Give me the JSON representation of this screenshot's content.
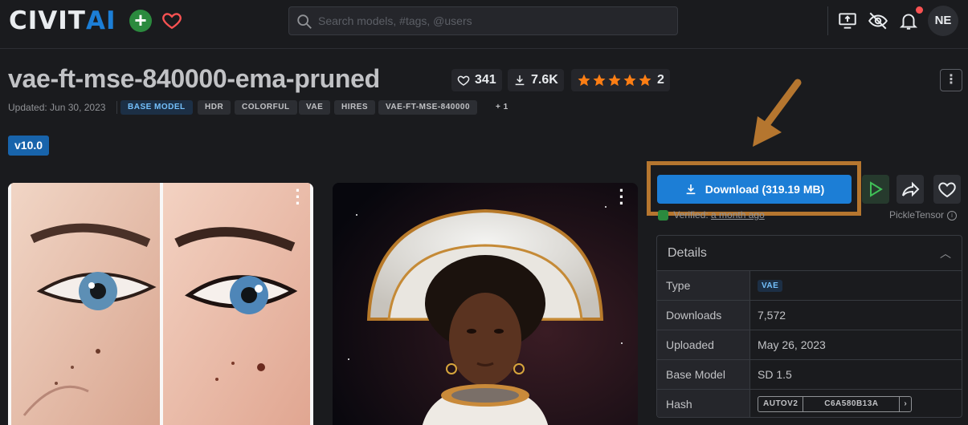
{
  "header": {
    "logo_civ": "CIVIT",
    "logo_ai": "AI",
    "search_placeholder": "Search models, #tags, @users",
    "avatar_initials": "NE",
    "icons": [
      "plus-icon",
      "heart-icon",
      "search-icon",
      "monitor-upload-icon",
      "eye-off-icon",
      "bell-icon"
    ],
    "accent": "#1c7ed6"
  },
  "model": {
    "title": "vae-ft-mse-840000-ema-pruned",
    "likes": "341",
    "downloads": "7.6K",
    "rating_count": "2",
    "rating_stars": 5,
    "updated": "Updated: Jun 30, 2023",
    "tags": [
      "BASE MODEL",
      "HDR",
      "COLORFUL",
      "VAE",
      "HIRES",
      "VAE-FT-MSE-840000",
      "+ 1"
    ],
    "version": "v10.0"
  },
  "actions": {
    "download_label": "Download (319.19 MB)",
    "verified_label": "Verified:",
    "verified_when": "a month ago",
    "author": "PickleTensor"
  },
  "details": {
    "heading": "Details",
    "rows": [
      {
        "label": "Type",
        "value": "VAE"
      },
      {
        "label": "Downloads",
        "value": "7,572"
      },
      {
        "label": "Uploaded",
        "value": "May 26, 2023"
      },
      {
        "label": "Base Model",
        "value": "SD 1.5"
      },
      {
        "label": "Hash",
        "value": ""
      }
    ],
    "hash_type": "AUTOV2",
    "hash_value": "C6A580B13A"
  },
  "colors": {
    "highlight": "#b5762f",
    "star": "#fd7e14",
    "primary_button": "#1c7ed6"
  }
}
